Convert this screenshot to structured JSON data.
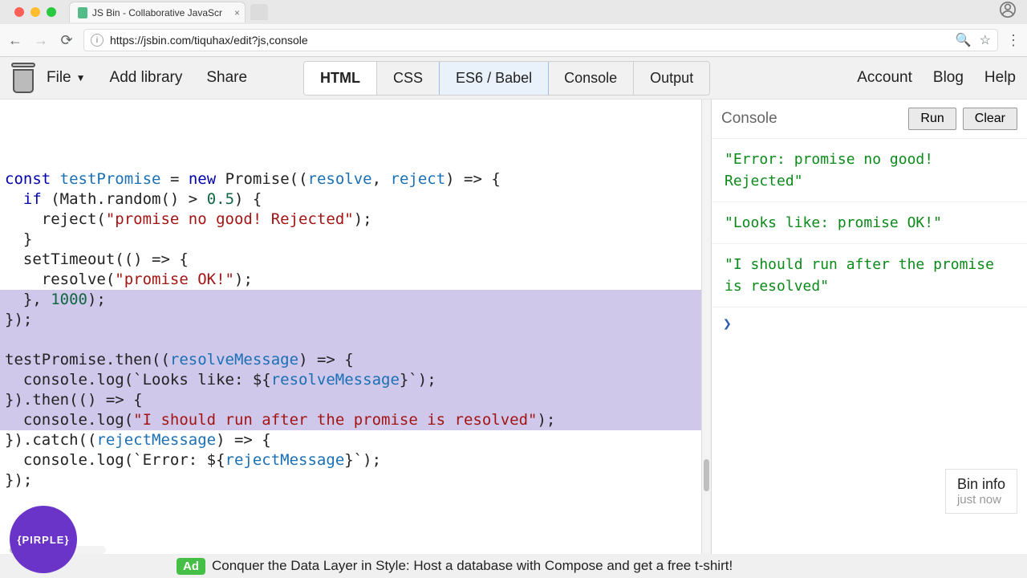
{
  "browser": {
    "tab_title": "JS Bin - Collaborative JavaScr",
    "url": "https://jsbin.com/tiquhax/edit?js,console"
  },
  "jsbin_menu": {
    "file": "File",
    "add_library": "Add library",
    "share": "Share",
    "account": "Account",
    "blog": "Blog",
    "help": "Help"
  },
  "panel_tabs": {
    "html": "HTML",
    "css": "CSS",
    "es6": "ES6 / Babel",
    "console": "Console",
    "output": "Output"
  },
  "code": {
    "l1a": "const",
    "l1b": " ",
    "l1c": "testPromise",
    "l1d": " = ",
    "l1e": "new",
    "l1f": " Promise((",
    "l1g": "resolve",
    "l1h": ", ",
    "l1i": "reject",
    "l1j": ") => {",
    "l2a": "  ",
    "l2b": "if",
    "l2c": " (Math.random() > ",
    "l2d": "0.5",
    "l2e": ") {",
    "l3a": "    reject(",
    "l3b": "\"promise no good! Rejected\"",
    "l3c": ");",
    "l4": "  }",
    "l5a": "  setTimeout(() => {",
    "l6a": "    resolve(",
    "l6b": "\"promise OK!\"",
    "l6c": ");",
    "l7a": "  }, ",
    "l7b": "1000",
    "l7c": ");",
    "l8": "});",
    "l9": " ",
    "l10a": "testPromise.then((",
    "l10b": "resolveMessage",
    "l10c": ") => {",
    "l11a": "  console.log(`Looks like: ${",
    "l11b": "resolveMessage",
    "l11c": "}`);",
    "l12": "}).then(() => {",
    "l13a": "  console.log(",
    "l13b": "\"I should run after the promise is resolved\"",
    "l13c": ");",
    "l14a": "}).catch((",
    "l14b": "rejectMessage",
    "l14c": ") => {",
    "l15a": "  console.log(`Error: ${",
    "l15b": "rejectMessage",
    "l15c": "}`);",
    "l16": "});"
  },
  "console": {
    "title": "Console",
    "run": "Run",
    "clear": "Clear",
    "rows": [
      "\"Error: promise no good! Rejected\"",
      "\"Looks like: promise OK!\"",
      "\"I should run after the promise is resolved\""
    ],
    "prompt": "❯"
  },
  "bin_info": {
    "title": "Bin info",
    "sub": "just now"
  },
  "ad": {
    "badge": "Ad",
    "text": "Conquer the Data Layer in Style: Host a database with Compose and get a free t-shirt!"
  },
  "pirple": "{PIRPLE}"
}
